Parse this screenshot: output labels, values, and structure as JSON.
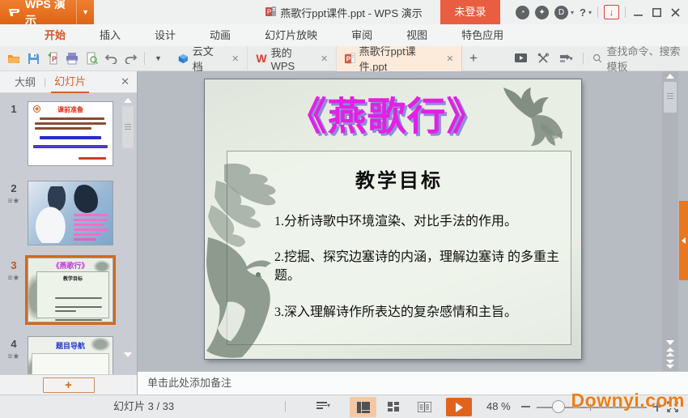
{
  "titlebar": {
    "app_button": "WPS 演示",
    "doc_title": "燕歌行ppt课件.ppt - WPS 演示",
    "login_label": "未登录",
    "help_label": "?"
  },
  "ribbon": {
    "tabs": [
      {
        "label": "开始",
        "active": true
      },
      {
        "label": "插入",
        "active": false
      },
      {
        "label": "设计",
        "active": false
      },
      {
        "label": "动画",
        "active": false
      },
      {
        "label": "幻灯片放映",
        "active": false
      },
      {
        "label": "审阅",
        "active": false
      },
      {
        "label": "视图",
        "active": false
      },
      {
        "label": "特色应用",
        "active": false
      }
    ]
  },
  "toolbar": {
    "doc_tabs": [
      {
        "label": "云文档",
        "active": false
      },
      {
        "label": "我的WPS",
        "active": false
      },
      {
        "label": "燕歌行ppt课件.ppt",
        "active": true
      }
    ],
    "new_tab_label": "+",
    "search_label": "查找命令、搜索模板"
  },
  "sidebar": {
    "tab_outline": "大纲",
    "tab_slides": "幻灯片",
    "add_slide_label": "+",
    "slides": [
      {
        "num": "1",
        "title": "课前准备",
        "has_star": false,
        "selected": false
      },
      {
        "num": "2",
        "title": "",
        "has_star": true,
        "selected": false
      },
      {
        "num": "3",
        "title": "《燕歌行》",
        "subtitle": "教学目标",
        "has_star": true,
        "selected": true
      },
      {
        "num": "4",
        "title": "题目导航",
        "has_star": true,
        "selected": false
      }
    ]
  },
  "slide": {
    "title": "《燕歌行》",
    "heading": "教学目标",
    "points": [
      "1.分析诗歌中环境渲染、对比手法的作用。",
      "2.挖掘、探究边塞诗的内涵，理解边塞诗 的多重主题。",
      "3.深入理解诗作所表达的复杂感情和主旨。"
    ]
  },
  "notes": {
    "placeholder": "单击此处添加备注"
  },
  "statusbar": {
    "slide_counter": "幻灯片 3 / 33",
    "zoom_level": "48 %",
    "watermark": "Downyi.com"
  },
  "colors": {
    "accent_orange": "#e8711d",
    "login_red": "#e95d41",
    "title_magenta": "#e320e3",
    "title_shadow_purple": "#8d8dd8",
    "active_tab_peach": "#fcebdb",
    "selected_thumb_border": "#d2691e",
    "watermark_orange": "#ef7d16"
  }
}
